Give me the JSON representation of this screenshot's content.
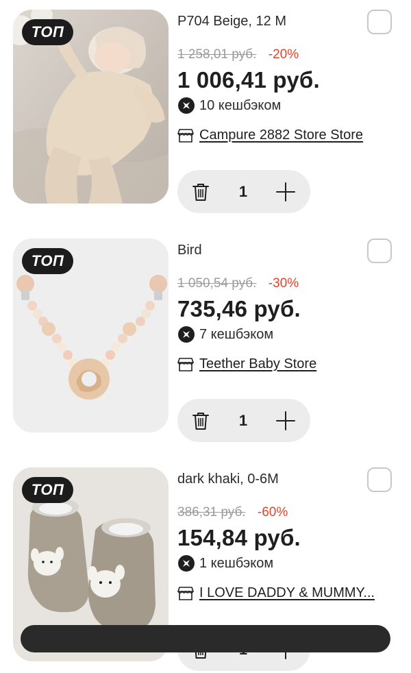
{
  "items": [
    {
      "badge": "ТОП",
      "title": "P704 Beige, 12 M",
      "old_price": "1 258,01 руб.",
      "discount": "-20%",
      "price": "1 006,41 руб.",
      "cashback": "10 кешбэком",
      "store": "Campure 2882 Store Store",
      "quantity": "1"
    },
    {
      "badge": "ТОП",
      "title": "Bird",
      "old_price": "1 050,54 руб.",
      "discount": "-30%",
      "price": "735,46 руб.",
      "cashback": "7 кешбэком",
      "store": "Teether Baby Store",
      "quantity": "1"
    },
    {
      "badge": "ТОП",
      "title": "dark khaki, 0-6M",
      "old_price": "386,31 руб.",
      "discount": "-60%",
      "price": "154,84 руб.",
      "cashback": "1 кешбэком",
      "store": "I LOVE DADDY & MUMMY...",
      "quantity": "1"
    }
  ],
  "icons": {
    "cashback": "cashback-icon",
    "store": "store-icon",
    "delete": "trash-icon",
    "increase": "plus-icon"
  },
  "colors": {
    "discount": "#e0442b",
    "badge_bg": "#1c1c1c",
    "stepper_bg": "#ececec"
  }
}
